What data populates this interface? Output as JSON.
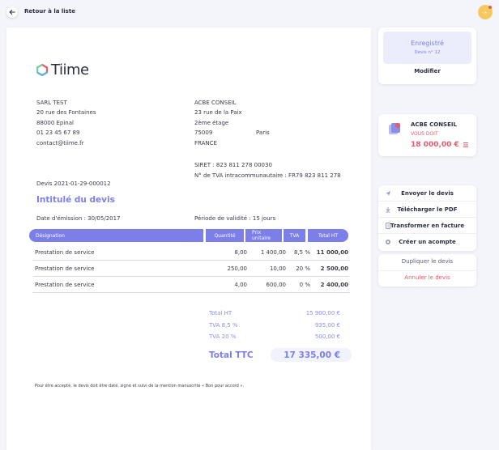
{
  "header": {
    "back_label": "Retour à la liste"
  },
  "logo": {
    "text": "Tiime"
  },
  "sender": {
    "name": "SARL TEST",
    "address1": "20 rue des Fontaines",
    "address2": "88000 Epinal",
    "phone": "01 23 45 67 89",
    "email": "contact@tiime.fr"
  },
  "recipient": {
    "name": "ACBE CONSEIL",
    "address1": "23 rue de la Paix",
    "address2": "2ème étage",
    "postcode": "75009",
    "city": "Paris",
    "country": "FRANCE",
    "siret": "SIRET :  823 811 278 00030",
    "tva": "N° de TVA intracommunautaire :  FR79  823 811 278"
  },
  "quote": {
    "number": "Devis 2021-01-29-000012",
    "title": "Intitulé du devis",
    "issue_date": "Date d'émission : 30/05/2017",
    "validity": "Période de validité : 15 jours"
  },
  "table": {
    "headers": [
      "Désignation",
      "Quantité",
      "Prix unitaire",
      "TVA",
      "Total HT"
    ],
    "rows": [
      {
        "desig": "Prestation de service",
        "qty": "8,00",
        "pu": "1 400,00",
        "tva": "8,5 %",
        "total": "11 000,00"
      },
      {
        "desig": "Prestation de service",
        "qty": "250,00",
        "pu": "10,00",
        "tva": "20 %",
        "total": "2 500,00"
      },
      {
        "desig": "Prestation de service",
        "qty": "4,00",
        "pu": "600,00",
        "tva": "0 %",
        "total": "2 400,00"
      }
    ]
  },
  "totals": {
    "ht_label": "Total HT",
    "ht_value": "15 900,00 €",
    "tva1_label": "TVA 8,5 %",
    "tva1_value": "935,00 €",
    "tva2_label": "TVA 20 %",
    "tva2_value": "500,00 €",
    "ttc_label": "Total TTC",
    "ttc_value": "17 335,00 €"
  },
  "footnote": "Pour être accepté, le devis doit être daté, signé et suivi de la mention manuscrite « Bon pour accord ».",
  "status": {
    "title": "Enregistré",
    "subtitle": "Devis n° 12",
    "modify_label": "Modifier"
  },
  "client": {
    "name": "ACBE CONSEIL",
    "label": "VOUS DOIT",
    "amount": "18 000,00 €"
  },
  "actions": [
    {
      "label": "Envoyer le devis",
      "icon": "send-icon"
    },
    {
      "label": "Télécharger le PDF",
      "icon": "download-icon"
    },
    {
      "label": "Transformer en facture",
      "icon": "invoice-icon"
    },
    {
      "label": "Créer un acompte",
      "icon": "deposit-icon"
    }
  ],
  "secondary": {
    "duplicate_label": "Dupliquer le devis",
    "cancel_label": "Annuler le devis"
  },
  "colors": {
    "accent": "#7d7fe8",
    "danger": "#e55b6c",
    "background": "#f4f5fb"
  }
}
